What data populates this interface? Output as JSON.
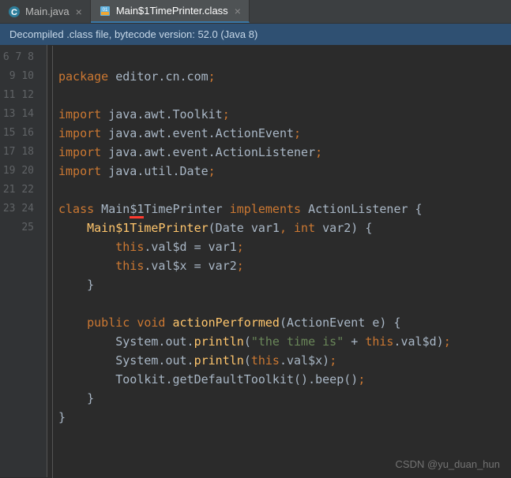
{
  "tabs": [
    {
      "label": "Main.java",
      "icon": "class-icon",
      "active": false
    },
    {
      "label": "Main$1TimePrinter.class",
      "icon": "bytecode-icon",
      "active": true
    }
  ],
  "banner": "Decompiled .class file, bytecode version: 52.0 (Java 8)",
  "gutter_start": 6,
  "gutter_end": 25,
  "watermark": "CSDN @yu_duan_hun",
  "code": {
    "package_kw": "package",
    "package_name": " editor.cn.com",
    "import_kw": "import",
    "imports": [
      " java.awt.Toolkit",
      " java.awt.event.ActionEvent",
      " java.awt.event.ActionListener",
      " java.util.Date"
    ],
    "class_kw": "class",
    "class_name": " Main",
    "class_name_ul": "$1",
    "class_name_rest": "TimePrinter ",
    "implements_kw": "implements",
    "iface": " ActionListener {",
    "ctor_name": "Main$1TimePrinter",
    "ctor_sig1": "(Date var1",
    "ctor_comma": ", ",
    "int_kw": "int",
    "ctor_sig2": " var2) {",
    "this_kw": "this",
    "line15": ".val$d = var1",
    "line16": ".val$x = var2",
    "close_brace": "}",
    "public_kw": "public",
    "void_kw": "void",
    "method_name": "actionPerformed",
    "method_sig": "(ActionEvent e) {",
    "sysout": "System.out.",
    "println": "println",
    "str_lit": "\"the time is\"",
    "plus": " + ",
    "vald": ".val$d)",
    "valx": ".val$x)",
    "toolkit": "Toolkit.",
    "getdef": "getDefaultToolkit",
    "beep": "().beep()",
    "semi": ";"
  }
}
